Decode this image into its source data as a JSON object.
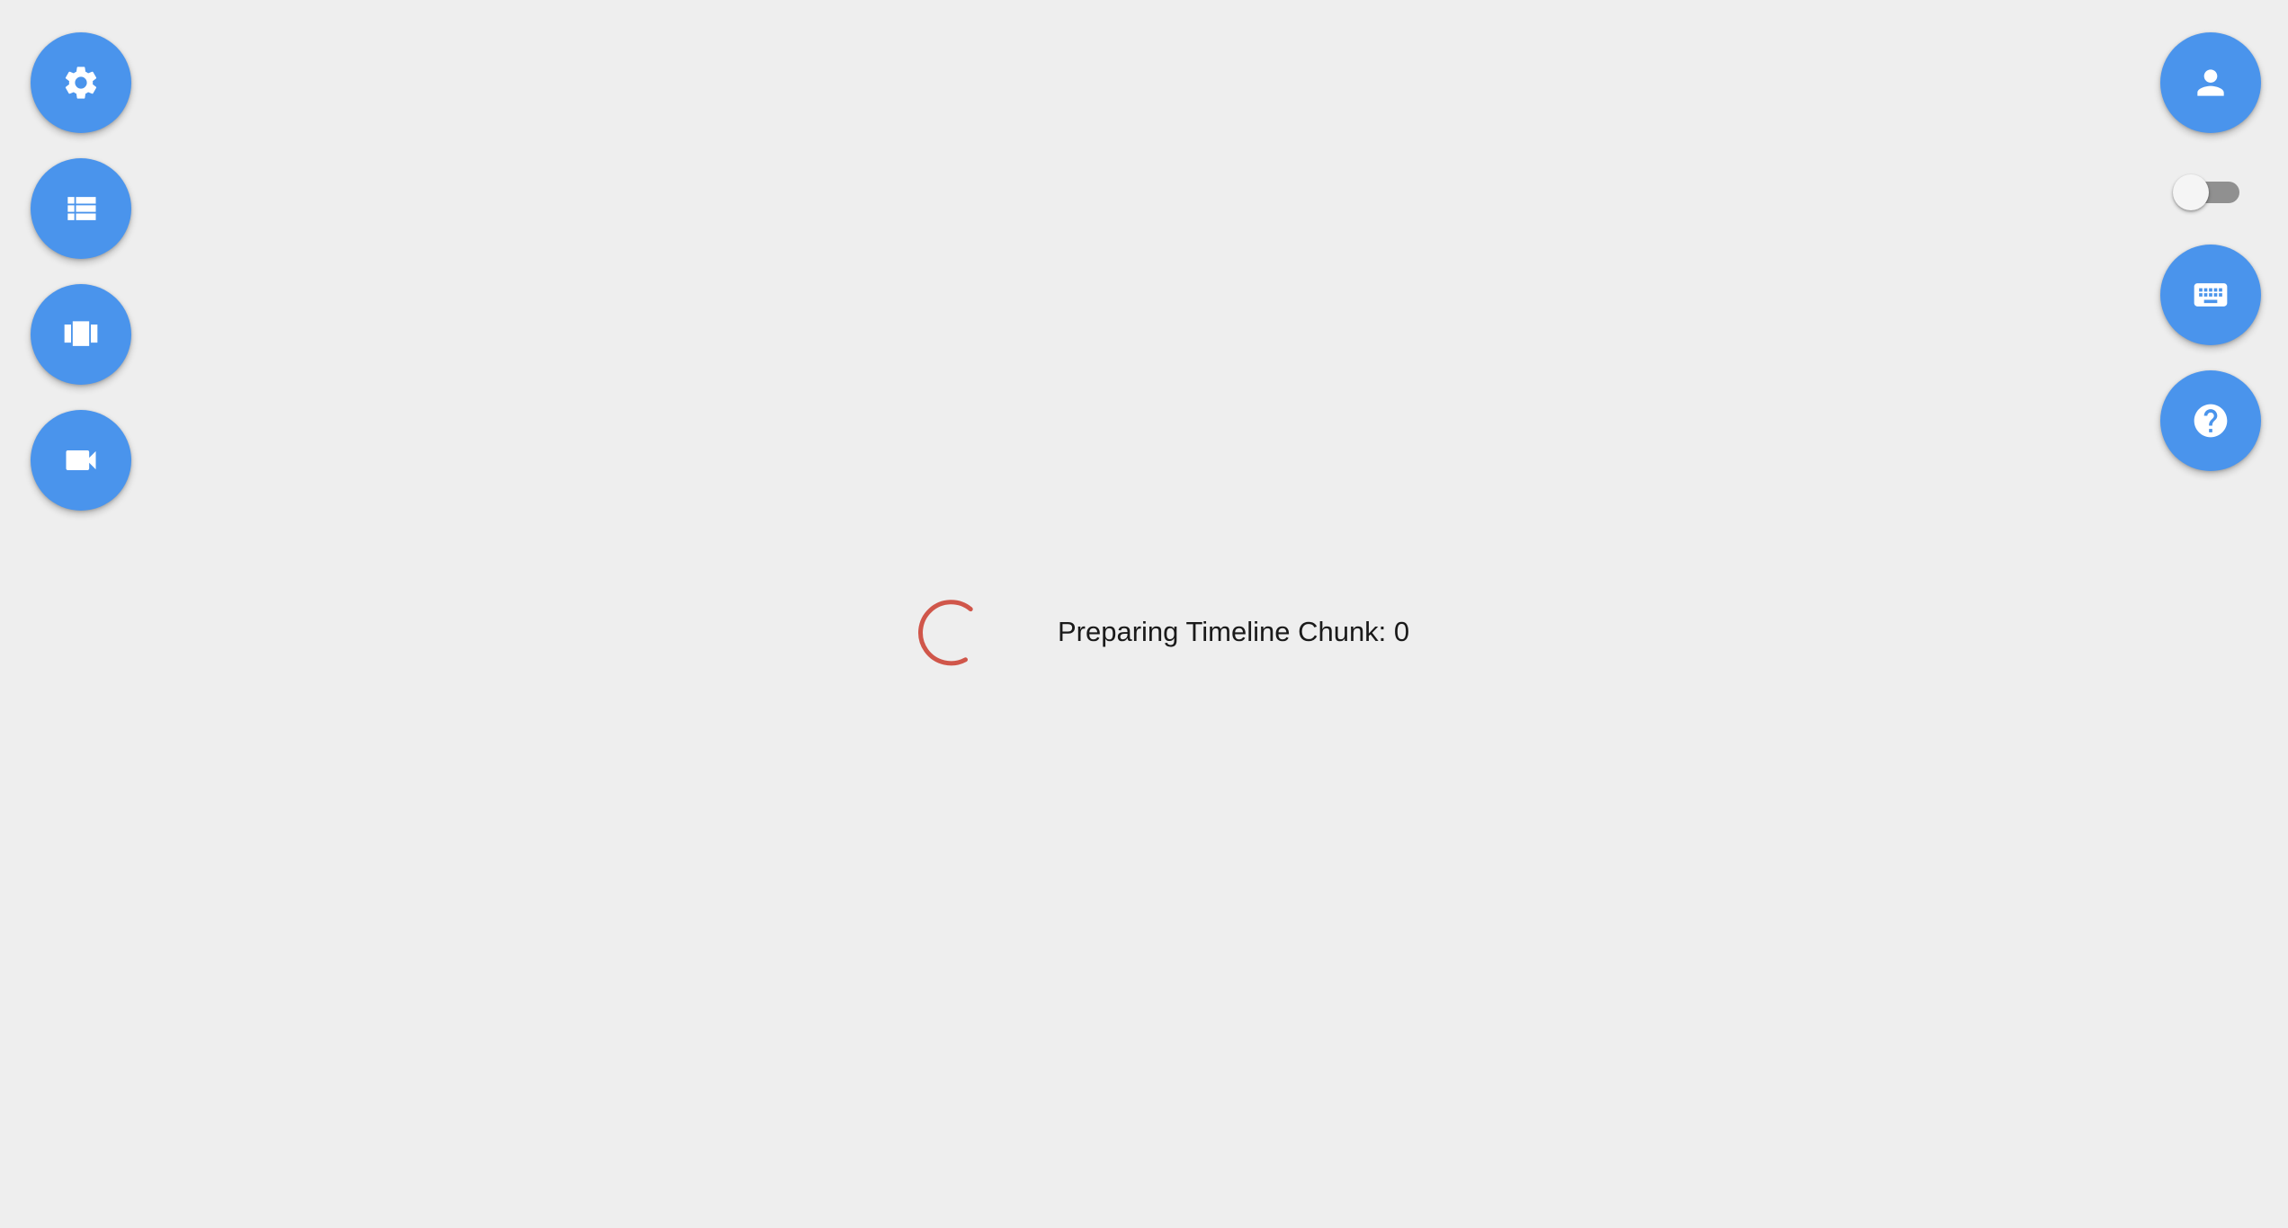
{
  "theme": {
    "accent": "#4a94ec",
    "spinner_color": "#d0564a",
    "background": "#eeeeee"
  },
  "left_toolbar": {
    "buttons": [
      {
        "icon": "gear-icon"
      },
      {
        "icon": "list-icon"
      },
      {
        "icon": "carousel-icon"
      },
      {
        "icon": "video-camera-icon"
      }
    ]
  },
  "right_toolbar": {
    "buttons": [
      {
        "icon": "person-icon"
      },
      {
        "icon": "keyboard-icon"
      },
      {
        "icon": "help-icon"
      }
    ],
    "toggle": {
      "state": "off"
    }
  },
  "status": {
    "text": "Preparing Timeline Chunk: 0"
  }
}
